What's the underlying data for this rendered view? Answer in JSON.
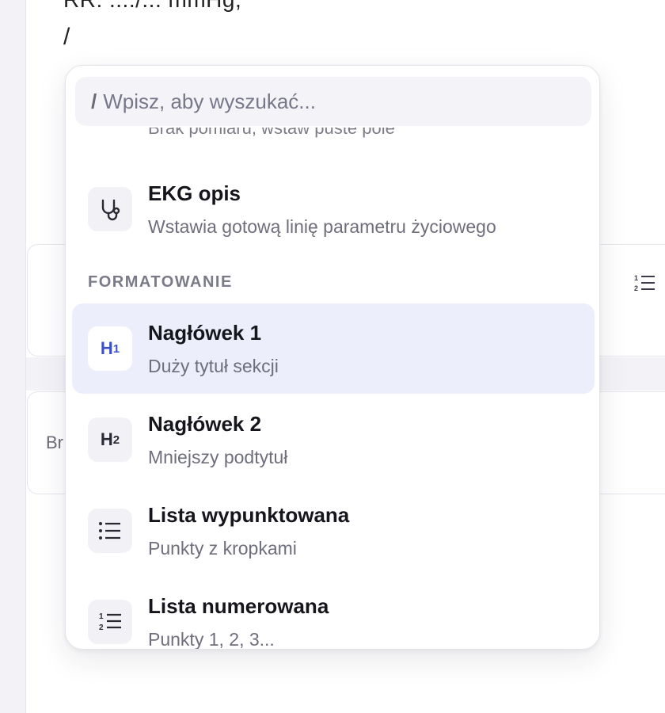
{
  "editor": {
    "cut_text": "RR: ..../... mmHg,",
    "slash_line": "/",
    "background_snippet": "Br"
  },
  "popup": {
    "search": {
      "slash": "/",
      "placeholder": "Wpisz, aby wyszukać..."
    },
    "clipped_previous_sub": "Brak pomiaru, wstaw puste pole",
    "items_top": [
      {
        "title": "EKG opis",
        "sub": "Wstawia gotową linię parametru życiowego",
        "icon": "stethoscope-icon"
      }
    ],
    "section": "FORMATOWANIE",
    "items": [
      {
        "title": "Nagłówek 1",
        "sub": "Duży tytuł sekcji",
        "icon": "heading-1-icon",
        "glyph": "H",
        "glyph_sub": "1",
        "active": true
      },
      {
        "title": "Nagłówek 2",
        "sub": "Mniejszy podtytuł",
        "icon": "heading-2-icon",
        "glyph": "H",
        "glyph_sub": "2",
        "active": false
      },
      {
        "title": "Lista wypunktowana",
        "sub": "Punkty z kropkami",
        "icon": "bullet-list-icon",
        "active": false
      },
      {
        "title": "Lista numerowana",
        "sub": "Punkty 1, 2, 3...",
        "icon": "numbered-list-icon",
        "active": false
      }
    ]
  },
  "colors": {
    "accent": "#3d52c9",
    "active_bg": "#eceefb"
  }
}
